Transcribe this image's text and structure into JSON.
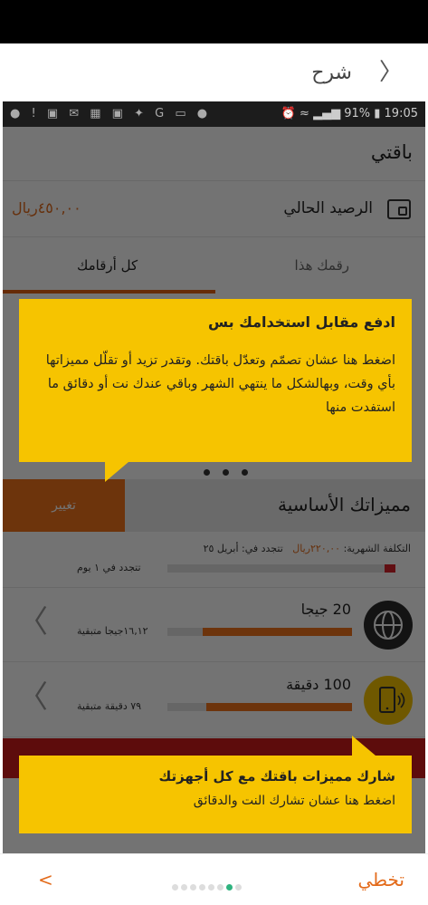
{
  "header": {
    "title": "شرح",
    "back_icon": "chevron-right-icon"
  },
  "status_bar": {
    "battery": "91%",
    "time": "19:05"
  },
  "app": {
    "title": "باقتي",
    "balance_label": "الرصيد الحالي",
    "balance_value": "٤٥٠,٠٠ريال",
    "tab_all": "كل أرقامك",
    "tab_this": "رقمك هذا",
    "features_title": "مميزاتك الأساسية",
    "change_button": "تغيير",
    "monthly_cost_label": "التكلفة الشهرية:",
    "monthly_cost_value": "٢٢٠,٠٠ريال",
    "renews_on": "تتجدد في: أبريل ٢٥",
    "renews_in": "تتجدد في ١ يوم",
    "data_feature": {
      "title": "20 جيجا",
      "remaining": "١٦,١٢جيجا متبقية",
      "fill_fraction": 0.81
    },
    "minutes_feature": {
      "title": "100 دقيقة",
      "remaining": "٧٩ دقيقة متبقية",
      "fill_fraction": 0.79
    }
  },
  "tooltips": {
    "top_title": "ادفع مقابل استخدامك بس",
    "top_body": "اضغط هنا عشان تصمّم وتعدّل باقتك. وتقدر تزيد أو تقلّل مميزاتها بأي وقت، وبهالشكل ما ينتهي الشهر وباقي عندك نت أو دقائق ما استفدت منها",
    "bottom_title": "شارك مميزات باقتك مع كل أجهزتك",
    "bottom_body": "اضغط هنا عشان تشارك النت والدقائق"
  },
  "footer": {
    "next": "<",
    "skip": "تخطي",
    "page_count": 8,
    "active_page": 7
  },
  "colors": {
    "accent": "#f2731c",
    "tooltip": "#f6c400",
    "active_dot": "#2fb37f"
  }
}
